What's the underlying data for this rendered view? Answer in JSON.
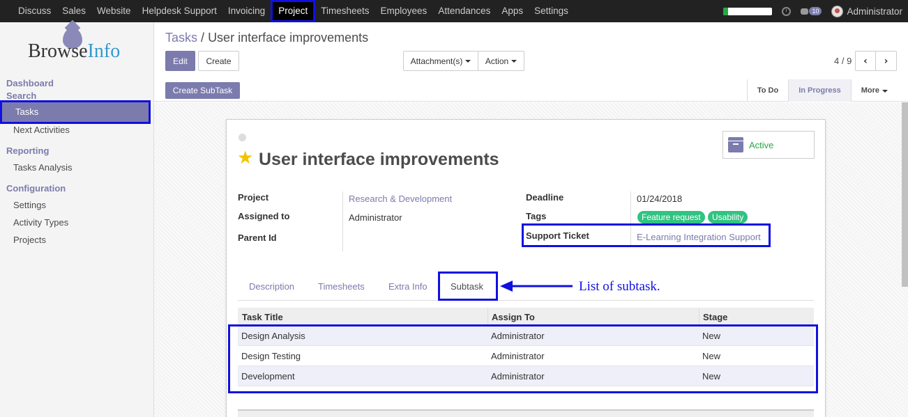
{
  "topbar": {
    "menu": [
      "Discuss",
      "Sales",
      "Website",
      "Helpdesk Support",
      "Invoicing",
      "Project",
      "Timesheets",
      "Employees",
      "Attendances",
      "Apps",
      "Settings"
    ],
    "active": "Project",
    "progress_fraction": 0.1,
    "chat_count": "10",
    "user": "Administrator"
  },
  "sidebar": {
    "logo": {
      "part1": "Browse",
      "part2": "Info"
    },
    "dashboard": "Dashboard",
    "search": "Search",
    "items_search": [
      "Tasks",
      "Next Activities"
    ],
    "reporting": "Reporting",
    "items_reporting": [
      "Tasks Analysis"
    ],
    "configuration": "Configuration",
    "items_config": [
      "Settings",
      "Activity Types",
      "Projects"
    ]
  },
  "breadcrumb": {
    "parent": "Tasks",
    "sep": "/",
    "current": "User interface improvements"
  },
  "buttons": {
    "edit": "Edit",
    "create": "Create",
    "attachments": "Attachment(s)",
    "action": "Action",
    "create_subtask": "Create SubTask"
  },
  "pager": {
    "text": "4 / 9"
  },
  "stages": [
    "To Do",
    "In Progress",
    "More"
  ],
  "record": {
    "title": "User interface improvements",
    "active_label": "Active",
    "fields_left": [
      {
        "label": "Project",
        "value": "Research & Development"
      },
      {
        "label": "Assigned to",
        "value": "Administrator"
      },
      {
        "label": "Parent Id",
        "value": ""
      }
    ],
    "fields_right": [
      {
        "label": "Deadline",
        "value": "01/24/2018"
      },
      {
        "label": "Tags",
        "value": ""
      },
      {
        "label": "Support Ticket",
        "value": "E-Learning Integration Support"
      }
    ],
    "tags": [
      "Feature request",
      "Usability"
    ],
    "colors": {
      "tag": "#30c381",
      "accent": "#7c7bad",
      "highlight": "#1010e0"
    }
  },
  "tabs": [
    "Description",
    "Timesheets",
    "Extra Info",
    "Subtask"
  ],
  "subtask_table": {
    "headers": [
      "Task Title",
      "Assign To",
      "Stage"
    ],
    "rows": [
      [
        "Design Analysis",
        "Administrator",
        "New"
      ],
      [
        "Design Testing",
        "Administrator",
        "New"
      ],
      [
        "Development",
        "Administrator",
        "New"
      ]
    ]
  },
  "annotation": "List of subtask."
}
